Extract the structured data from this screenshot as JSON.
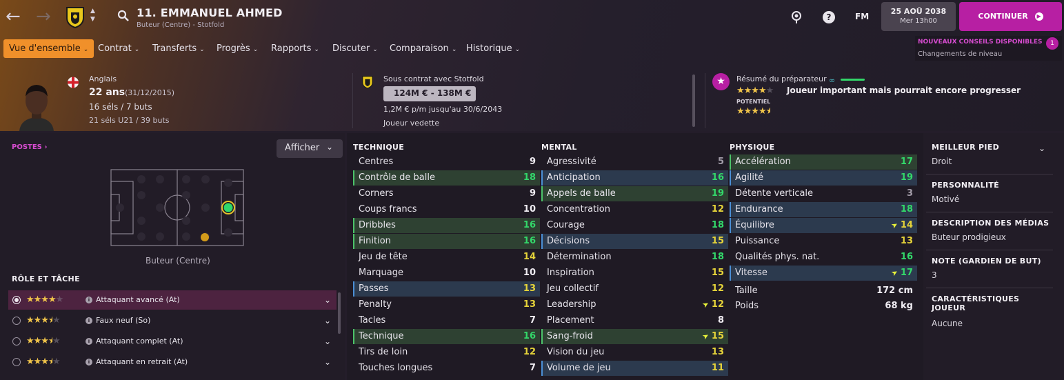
{
  "header": {
    "title": "11. EMMANUEL AHMED",
    "subtitle": "Buteur (Centre) - Stotfold",
    "date": "25 AOÛ 2038",
    "time": "Mer 13h00",
    "fm_label": "FM",
    "continue_label": "CONTINUER"
  },
  "menu": {
    "items": [
      {
        "label": "Vue d'ensemble"
      },
      {
        "label": "Contrat"
      },
      {
        "label": "Transferts"
      },
      {
        "label": "Progrès"
      },
      {
        "label": "Rapports"
      },
      {
        "label": "Discuter"
      },
      {
        "label": "Comparaison"
      },
      {
        "label": "Historique"
      }
    ]
  },
  "notification": {
    "title": "NOUVEAUX CONSEILS DISPONIBLES",
    "subtitle": "Changements de niveau",
    "count": "1"
  },
  "player": {
    "nationality": "Anglais",
    "age": "22 ans",
    "dob": "(31/12/2015)",
    "caps": "16 séls / 7 buts",
    "u21": "21 séls U21 / 39 buts"
  },
  "contract": {
    "club_line": "Sous contrat avec Stotfold",
    "value": "124M € - 138M €",
    "wage": "1,2M € p/m jusqu'au 30/6/2043",
    "status": "Joueur vedette"
  },
  "coach": {
    "title": "Résumé du préparateur",
    "summary": "Joueur important mais pourrait encore progresser",
    "potential_label": "POTENTIEL",
    "ability_stars": 4,
    "potential_stars": 4.5
  },
  "positions": {
    "title": "POSTES",
    "show_label": "Afficher",
    "caption": "Buteur (Centre)"
  },
  "roles": {
    "title": "RÔLE ET TÂCHE",
    "items": [
      {
        "label": "Attaquant avancé (At)",
        "stars": 4
      },
      {
        "label": "Faux neuf (So)",
        "stars": 3.5
      },
      {
        "label": "Attaquant complet (At)",
        "stars": 3.5
      },
      {
        "label": "Attaquant en retrait (At)",
        "stars": 3.5
      }
    ]
  },
  "technique": {
    "title": "TECHNIQUE",
    "rows": [
      {
        "name": "Centres",
        "value": "9",
        "hl": "",
        "arrow": false
      },
      {
        "name": "Contrôle de balle",
        "value": "18",
        "hl": "green",
        "arrow": false
      },
      {
        "name": "Corners",
        "value": "9",
        "hl": "",
        "arrow": false
      },
      {
        "name": "Coups francs",
        "value": "10",
        "hl": "",
        "arrow": false
      },
      {
        "name": "Dribbles",
        "value": "16",
        "hl": "green",
        "arrow": false
      },
      {
        "name": "Finition",
        "value": "16",
        "hl": "green",
        "arrow": false
      },
      {
        "name": "Jeu de tête",
        "value": "14",
        "hl": "",
        "arrow": false
      },
      {
        "name": "Marquage",
        "value": "10",
        "hl": "",
        "arrow": false
      },
      {
        "name": "Passes",
        "value": "13",
        "hl": "blue",
        "arrow": false
      },
      {
        "name": "Penalty",
        "value": "13",
        "hl": "",
        "arrow": false
      },
      {
        "name": "Tacles",
        "value": "7",
        "hl": "",
        "arrow": false
      },
      {
        "name": "Technique",
        "value": "16",
        "hl": "green",
        "arrow": false
      },
      {
        "name": "Tirs de loin",
        "value": "12",
        "hl": "",
        "arrow": false
      },
      {
        "name": "Touches longues",
        "value": "7",
        "hl": "",
        "arrow": false
      }
    ]
  },
  "mental": {
    "title": "MENTAL",
    "rows": [
      {
        "name": "Agressivité",
        "value": "5",
        "hl": "",
        "arrow": false
      },
      {
        "name": "Anticipation",
        "value": "16",
        "hl": "blue",
        "arrow": false
      },
      {
        "name": "Appels de balle",
        "value": "19",
        "hl": "green",
        "arrow": false
      },
      {
        "name": "Concentration",
        "value": "12",
        "hl": "",
        "arrow": false
      },
      {
        "name": "Courage",
        "value": "18",
        "hl": "",
        "arrow": false
      },
      {
        "name": "Décisions",
        "value": "15",
        "hl": "blue",
        "arrow": false
      },
      {
        "name": "Détermination",
        "value": "18",
        "hl": "",
        "arrow": false
      },
      {
        "name": "Inspiration",
        "value": "15",
        "hl": "",
        "arrow": false
      },
      {
        "name": "Jeu collectif",
        "value": "12",
        "hl": "",
        "arrow": false
      },
      {
        "name": "Leadership",
        "value": "12",
        "hl": "",
        "arrow": true
      },
      {
        "name": "Placement",
        "value": "8",
        "hl": "",
        "arrow": false
      },
      {
        "name": "Sang-froid",
        "value": "15",
        "hl": "green",
        "arrow": true
      },
      {
        "name": "Vision du jeu",
        "value": "13",
        "hl": "",
        "arrow": false
      },
      {
        "name": "Volume de jeu",
        "value": "11",
        "hl": "blue",
        "arrow": false
      }
    ]
  },
  "physique": {
    "title": "PHYSIQUE",
    "rows": [
      {
        "name": "Accélération",
        "value": "17",
        "hl": "green",
        "arrow": false
      },
      {
        "name": "Agilité",
        "value": "19",
        "hl": "blue",
        "arrow": false
      },
      {
        "name": "Détente verticale",
        "value": "3",
        "hl": "",
        "arrow": false
      },
      {
        "name": "Endurance",
        "value": "18",
        "hl": "blue",
        "arrow": false
      },
      {
        "name": "Équilibre",
        "value": "14",
        "hl": "blue",
        "arrow": true
      },
      {
        "name": "Puissance",
        "value": "13",
        "hl": "",
        "arrow": false
      },
      {
        "name": "Qualités phys. nat.",
        "value": "16",
        "hl": "",
        "arrow": false
      },
      {
        "name": "Vitesse",
        "value": "17",
        "hl": "blue",
        "arrow": true
      }
    ],
    "height_label": "Taille",
    "height": "172 cm",
    "weight_label": "Poids",
    "weight": "68 kg"
  },
  "side": {
    "best_foot_label": "MEILLEUR PIED",
    "best_foot": "Droit",
    "personality_label": "PERSONNALITÉ",
    "personality": "Motivé",
    "media_label": "DESCRIPTION DES MÉDIAS",
    "media": "Buteur prodigieux",
    "gk_label": "NOTE (GARDIEN DE BUT)",
    "gk": "3",
    "traits_label": "CARACTÉRISTIQUES JOUEUR",
    "traits": "Aucune"
  },
  "colors": {
    "accent_orange": "#f0902a",
    "continue_magenta": "#b71fa3",
    "good_green": "#33d86a",
    "mid_yellow": "#e6d43a"
  }
}
